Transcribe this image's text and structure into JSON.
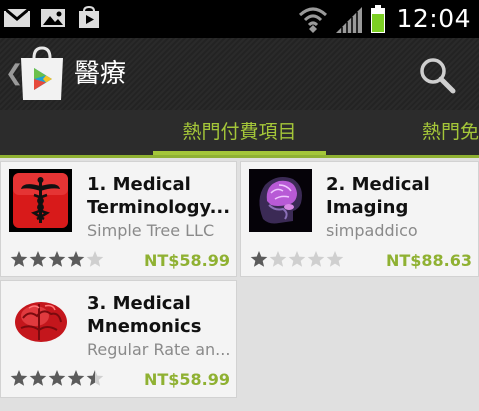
{
  "status_bar": {
    "time": "12:04",
    "icons": [
      "gmail-icon",
      "gallery-icon",
      "play-store-icon",
      "wifi-icon",
      "signal-icon",
      "battery-icon"
    ]
  },
  "action_bar": {
    "title": "醫療",
    "icons": [
      "back-icon",
      "play-store-logo",
      "search-icon"
    ]
  },
  "tabs": [
    {
      "label": "熱門付費項目",
      "active": true
    },
    {
      "label": "熱門免",
      "active": false
    }
  ],
  "apps": [
    {
      "title": "1. Medical Terminology...",
      "developer": "Simple Tree LLC",
      "price": "NT$58.99",
      "rating": 4,
      "icon": "caduceus-icon"
    },
    {
      "title": "2. Medical Imaging",
      "developer": "simpaddico",
      "price": "NT$88.63",
      "rating": 1,
      "icon": "brain-scan-icon"
    },
    {
      "title": "3. Medical Mnemonics",
      "developer": "Regular Rate an...",
      "price": "NT$58.99",
      "rating": 4.5,
      "icon": "red-brain-icon"
    }
  ],
  "colors": {
    "accent": "#a4c639",
    "price": "#8fb132",
    "star_filled": "#5b5b5b",
    "star_empty": "#cfcfcf"
  }
}
